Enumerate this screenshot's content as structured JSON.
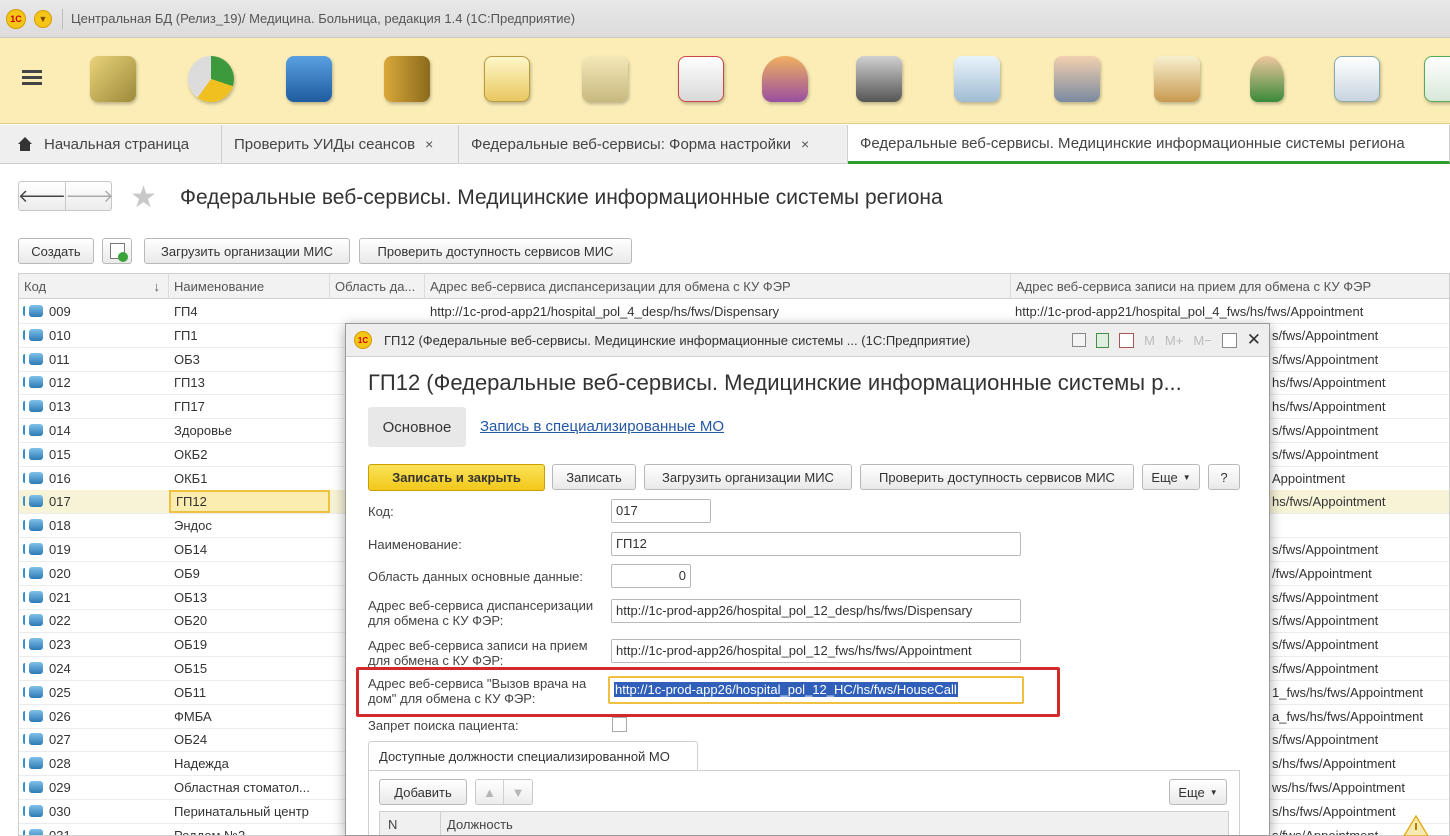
{
  "titlebar": {
    "logo_text": "1С",
    "title": "Центральная БД (Релиз_19)/  Медицина. Больница, редакция 1.4  (1С:Предприятие)"
  },
  "toolbar": {
    "icons": [
      "money-icon",
      "pie-chart-icon",
      "building-icon",
      "binders-icon",
      "help-document-icon",
      "laptop-icon",
      "first-aid-kit-icon",
      "person-icon",
      "cash-register-icon",
      "hospital-bed-icon",
      "doctor-computer-icon",
      "clipboard-chart-icon",
      "user-icon",
      "documents-icon",
      "mail-icon"
    ]
  },
  "tabs": [
    {
      "label": "Начальная страница",
      "closable": false
    },
    {
      "label": "Проверить УИДы сеансов",
      "closable": true
    },
    {
      "label": "Федеральные веб-сервисы: Форма настройки",
      "closable": true
    },
    {
      "label": "Федеральные веб-сервисы. Медицинские информационные системы региона",
      "closable": false
    }
  ],
  "close_glyph": "×",
  "page": {
    "title": "Федеральные веб-сервисы. Медицинские информационные системы региона",
    "buttons": {
      "create": "Создать",
      "load_orgs": "Загрузить организации МИС",
      "check_availability": "Проверить доступность сервисов МИС"
    }
  },
  "list": {
    "columns": {
      "code": "Код",
      "sort_arrow": "↓",
      "name": "Наименование",
      "area": "Область да...",
      "disp_url": "Адрес веб-сервиса диспансеризации для обмена с КУ ФЭР",
      "appt_url": "Адрес веб-сервиса записи на прием для обмена с КУ ФЭР"
    },
    "rows": [
      {
        "code": "009",
        "name": "ГП4",
        "disp": "http://1c-prod-app21/hospital_pol_4_desp/hs/fws/Dispensary",
        "appt": "http://1c-prod-app21/hospital_pol_4_fws/hs/fws/Appointment"
      },
      {
        "code": "010",
        "name": "ГП1",
        "disp": "",
        "appt": "s/fws/Appointment"
      },
      {
        "code": "011",
        "name": "ОБ3",
        "disp": "",
        "appt": "s/fws/Appointment"
      },
      {
        "code": "012",
        "name": "ГП13",
        "disp": "",
        "appt": "hs/fws/Appointment"
      },
      {
        "code": "013",
        "name": "ГП17",
        "disp": "",
        "appt": "hs/fws/Appointment"
      },
      {
        "code": "014",
        "name": "Здоровье",
        "disp": "",
        "appt": "s/fws/Appointment"
      },
      {
        "code": "015",
        "name": "ОКБ2",
        "disp": "",
        "appt": "s/fws/Appointment"
      },
      {
        "code": "016",
        "name": "ОКБ1",
        "disp": "",
        "appt": "Appointment"
      },
      {
        "code": "017",
        "name": "ГП12",
        "disp": "",
        "appt": "hs/fws/Appointment"
      },
      {
        "code": "018",
        "name": "Эндос",
        "disp": "",
        "appt": ""
      },
      {
        "code": "019",
        "name": "ОБ14",
        "disp": "",
        "appt": "s/fws/Appointment"
      },
      {
        "code": "020",
        "name": "ОБ9",
        "disp": "",
        "appt": "/fws/Appointment"
      },
      {
        "code": "021",
        "name": "ОБ13",
        "disp": "",
        "appt": "s/fws/Appointment"
      },
      {
        "code": "022",
        "name": "ОБ20",
        "disp": "",
        "appt": "s/fws/Appointment"
      },
      {
        "code": "023",
        "name": "ОБ19",
        "disp": "",
        "appt": "s/fws/Appointment"
      },
      {
        "code": "024",
        "name": "ОБ15",
        "disp": "",
        "appt": "s/fws/Appointment"
      },
      {
        "code": "025",
        "name": "ОБ11",
        "disp": "",
        "appt": "1_fws/hs/fws/Appointment"
      },
      {
        "code": "026",
        "name": "ФМБА",
        "disp": "",
        "appt": "a_fws/hs/fws/Appointment"
      },
      {
        "code": "027",
        "name": "ОБ24",
        "disp": "",
        "appt": "s/fws/Appointment"
      },
      {
        "code": "028",
        "name": "Надежда",
        "disp": "",
        "appt": "s/hs/fws/Appointment"
      },
      {
        "code": "029",
        "name": "Областная стоматол...",
        "disp": "",
        "appt": "ws/hs/fws/Appointment"
      },
      {
        "code": "030",
        "name": "Перинатальный центр",
        "disp": "",
        "appt": "s/hs/fws/Appointment"
      },
      {
        "code": "031",
        "name": "Роддом №3",
        "disp": "",
        "appt": "s/fws/Appointment"
      }
    ]
  },
  "modal": {
    "logo_text": "1С",
    "window_title": "ГП12 (Федеральные веб-сервисы. Медицинские информационные системы ...  (1С:Предприятие)",
    "title_icons": {
      "m": "M",
      "m_plus": "M+",
      "m_minus": "M−"
    },
    "heading": "ГП12 (Федеральные веб-сервисы. Медицинские информационные системы р...",
    "tab_main": "Основное",
    "tab_referral": "Запись в специализированные МО",
    "buttons": {
      "save_close": "Записать и закрыть",
      "save": "Записать",
      "load_orgs": "Загрузить организации МИС",
      "check": "Проверить доступность сервисов МИС",
      "more": "Еще",
      "help": "?"
    },
    "fields": {
      "code_label": "Код:",
      "code_value": "017",
      "name_label": "Наименование:",
      "name_value": "ГП12",
      "area_label": "Область данных основные данные:",
      "area_value": "0",
      "disp_label": "Адрес веб-сервиса диспансеризации для обмена с КУ ФЭР:",
      "disp_value": "http://1c-prod-app26/hospital_pol_12_desp/hs/fws/Dispensary",
      "appt_label": "Адрес веб-сервиса записи на прием для обмена с КУ ФЭР:",
      "appt_value": "http://1c-prod-app26/hospital_pol_12_fws/hs/fws/Appointment",
      "housecall_label": "Адрес веб-сервиса \"Вызов врача на дом\" для обмена с КУ ФЭР:",
      "housecall_value": "http://1c-prod-app26/hospital_pol_12_HC/hs/fws/HouseCall",
      "patient_search_label": "Запрет поиска пациента:"
    },
    "subtab": "Доступные должности специализированной МО",
    "sub_buttons": {
      "add": "Добавить",
      "more": "Еще"
    },
    "sub_columns": {
      "n": "N",
      "position": "Должность"
    }
  },
  "colors": {
    "toolbar_bg": "#fbedb5",
    "active_tab_accent": "#2a9d2a",
    "primary_button": "#f5cf2a",
    "highlight_frame": "#d22a2a",
    "link": "#2357a5"
  }
}
